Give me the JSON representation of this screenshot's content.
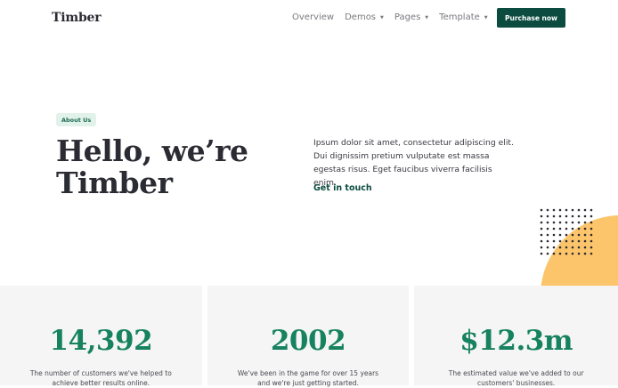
{
  "header": {
    "logo": "Timber",
    "menu": [
      {
        "label": "Overview",
        "caret": false
      },
      {
        "label": "Demos",
        "caret": true
      },
      {
        "label": "Pages",
        "caret": true
      },
      {
        "label": "Template",
        "caret": true
      }
    ],
    "purchase_label": "Purchase now"
  },
  "hero": {
    "badge": "About Us",
    "title_line1": "Hello, we’re",
    "title_line2": "Timber",
    "description": "Ipsum dolor sit amet, consectetur adipiscing elit. Dui dignissim pretium vulputate est massa egestas risus. Eget faucibus viverra facilisis enim.",
    "cta": "Get in touch"
  },
  "stats": [
    {
      "value": "14,392",
      "description": "The number of customers we've helped to achieve better results online."
    },
    {
      "value": "2002",
      "description": "We've been in the game for over 15 years and we're just getting started."
    },
    {
      "value": "$12.3m",
      "description": "The estimated value we've added to our customers' businesses."
    }
  ],
  "colors": {
    "brand": "#0c4b40",
    "accent_green": "#16825f",
    "badge_bg": "#e1f2ea",
    "circle": "#fcc56b"
  }
}
